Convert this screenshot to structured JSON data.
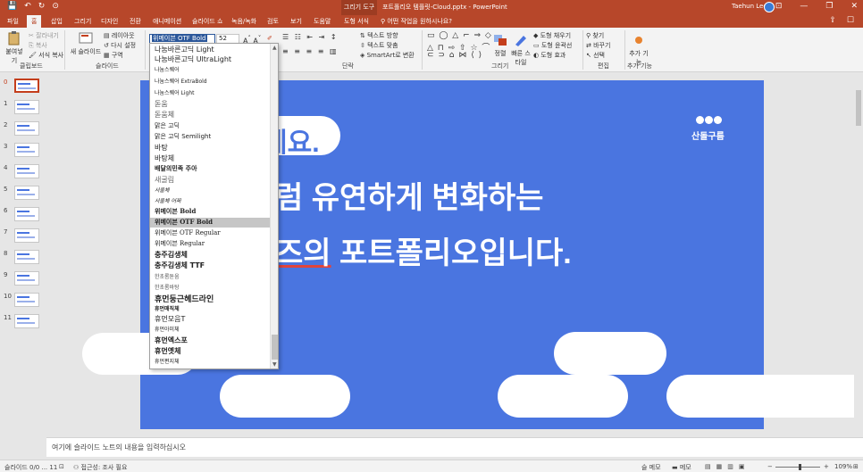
{
  "titlebar": {
    "qat": [
      "💾",
      "↶",
      "↻",
      "⊙"
    ],
    "context_tab": "그리기 도구",
    "title": "포트폴리오 템플릿-Cloud.pptx  -  PowerPoint",
    "user": "Taehun Lee",
    "window_buttons": [
      "⊡",
      "—",
      "❐",
      "✕"
    ]
  },
  "tabs": [
    "파일",
    "홈",
    "삽입",
    "그리기",
    "디자인",
    "전환",
    "애니메이션",
    "슬라이드 쇼",
    "녹음/녹화",
    "검토",
    "보기",
    "도움말",
    "도형 서식"
  ],
  "tell_me": "어떤 작업을 원하시나요?",
  "ribbon": {
    "paste": "붙여넣기",
    "cut": "잘라내기",
    "copy": "복사",
    "format_painter": "서식 복사",
    "clipboard": "클립보드",
    "new_slide": "새 슬라이드",
    "layout": "레이아웃",
    "reset": "다시 설정",
    "section": "구역",
    "slides": "슬라이드",
    "font_name": "위메이븐 OTF Bold",
    "font_size": "52",
    "paragraph": "단락",
    "text_direction": "텍스트 방향",
    "align_text": "텍스트 맞춤",
    "smartart": "SmartArt로 변환",
    "arrange": "정렬",
    "quick_styles": "빠른 스타일",
    "shape_fill": "도형 채우기",
    "shape_outline": "도형 윤곽선",
    "shape_effects": "도형 효과",
    "drawing": "그리기",
    "find": "찾기",
    "replace": "바꾸기",
    "select": "선택",
    "editing": "편집",
    "addin": "추가 기능",
    "addin_group": "추가 기능"
  },
  "fonts": [
    "나눔바른고딕 Light",
    "나눔바른고딕 UltraLight",
    "나눔스퀘어",
    "나눔스퀘어 ExtraBold",
    "나눔스퀘어 Light",
    "돋움",
    "돋움체",
    "맑은 고딕",
    "맑은 고딕 Semilight",
    "바탕",
    "바탕체",
    "배달의민족 주아",
    "새굴림",
    "서울체",
    "서울체 어쩌",
    "위메이븐 Bold",
    "위메이븐 OTF Bold",
    "위메이븐 OTF Regular",
    "위메이븐 Regular",
    "충주김생체",
    "충주김생체 TTF",
    "한초롬돋움",
    "한초롬바탕",
    "휴먼둥근헤드라인",
    "휴먼매직체",
    "휴먼모음T",
    "휴먼아미체",
    "휴먼엑스포",
    "휴먼옛체",
    "휴먼편지체"
  ],
  "slide": {
    "headline_fragment": "세요.",
    "line1": "럼 유연하게 변화하는",
    "line2_underlined": "즈의",
    "line2_rest": " 포트폴리오입니다.",
    "logo_text": "산돌구름"
  },
  "slide_numbers": [
    "0",
    "1",
    "2",
    "3",
    "4",
    "5",
    "6",
    "7",
    "8",
    "9",
    "10",
    "11"
  ],
  "notes_placeholder": "여기에 슬라이드 노트의 내용을 입력하십시오",
  "status": {
    "slide_count": "슬라이드 0/0 ... 11",
    "accessibility": "접근성: 조사 필요",
    "notes": "슬 메모",
    "comments": "메모",
    "zoom": "109%"
  },
  "colors": {
    "accent": "#b7472a",
    "slide_bg": "#4a75e0",
    "selected_font_highlight": "#c6c6c6"
  }
}
